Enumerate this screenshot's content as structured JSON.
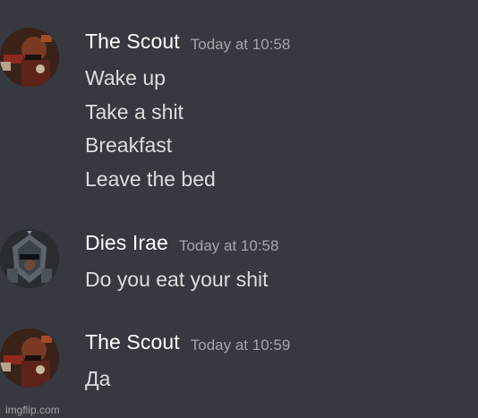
{
  "messages": [
    {
      "username": "The Scout",
      "timestamp": "Today at 10:58",
      "avatar_icon": "scout-avatar-icon",
      "lines": [
        "Wake up",
        "Take a shit",
        "Breakfast",
        "Leave the bed"
      ]
    },
    {
      "username": "Dies Irae",
      "timestamp": "Today at 10:58",
      "avatar_icon": "dies-irae-avatar-icon",
      "lines": [
        "Do you eat your shit"
      ]
    },
    {
      "username": "The Scout",
      "timestamp": "Today at 10:59",
      "avatar_icon": "scout-avatar-icon",
      "lines": [
        "Да"
      ]
    }
  ],
  "watermark": "imgflip.com",
  "colors": {
    "background": "#36393f",
    "username": "#ffffff",
    "timestamp": "#a3a6aa",
    "message_text": "#dcddde"
  }
}
